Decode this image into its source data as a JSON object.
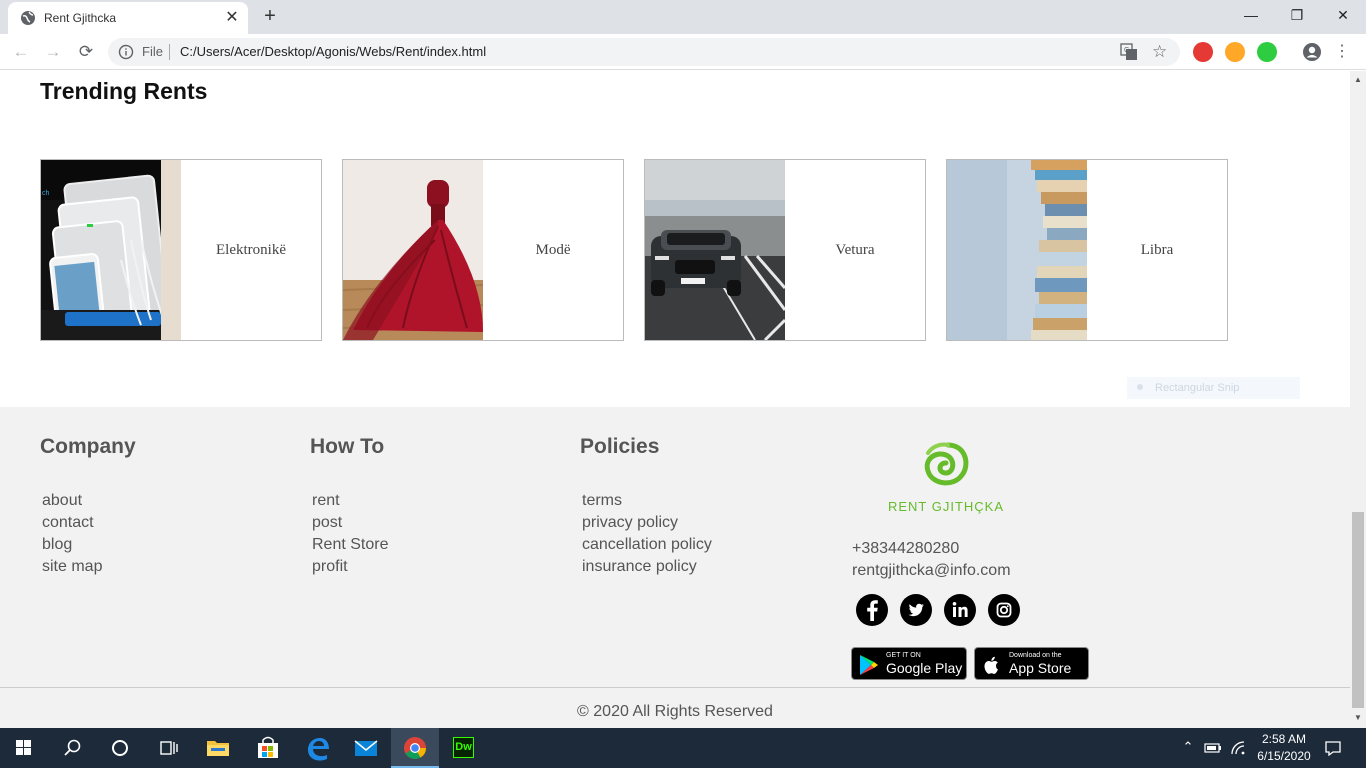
{
  "browser": {
    "tab_title": "Rent Gjithcka",
    "tab_close": "✕",
    "new_tab": "+",
    "window_controls": {
      "minimize": "—",
      "restore": "❐",
      "close": "✕"
    },
    "nav": {
      "back": "←",
      "forward": "→",
      "reload": "⟳"
    },
    "address": {
      "scheme": "File",
      "url": "C:/Users/Acer/Desktop/Agonis/Webs/Rent/index.html"
    },
    "star": "☆",
    "menu": "⋮",
    "extensions": [
      {
        "name": "red-extension-icon",
        "color": "#e53935"
      },
      {
        "name": "orange-extension-icon",
        "color": "#ffa726"
      },
      {
        "name": "green-extension-icon",
        "color": "#2ecc40"
      }
    ]
  },
  "page": {
    "section_title": "Trending Rents",
    "categories": [
      {
        "label": "Elektronikë",
        "image": "tablets-charging-station"
      },
      {
        "label": "Modë",
        "image": "red-ball-gown"
      },
      {
        "label": "Vetura",
        "image": "suv-on-road"
      },
      {
        "label": "Libra",
        "image": "stack-of-books"
      }
    ],
    "snip_overlay": "Rectangular Snip"
  },
  "footer": {
    "columns": [
      {
        "heading": "Company",
        "links": [
          "about",
          "contact",
          "blog",
          "site map"
        ]
      },
      {
        "heading": "How To",
        "links": [
          "rent",
          "post",
          "Rent Store",
          "profit"
        ]
      },
      {
        "heading": "Policies",
        "links": [
          "terms",
          "privacy policy",
          "cancellation policy",
          "insurance policy"
        ]
      }
    ],
    "brand": "RENT GJITHÇKA",
    "brand_color": "#66bb2a",
    "phone": "+38344280280",
    "email": "rentgjithcka@info.com",
    "social": [
      "facebook-icon",
      "twitter-icon",
      "linkedin-icon",
      "instagram-icon"
    ],
    "stores": {
      "google": {
        "small": "GET IT ON",
        "big": "Google Play"
      },
      "apple": {
        "small": "Download on the",
        "big": "App Store"
      }
    },
    "copyright": "© 2020 All Rights Reserved"
  },
  "taskbar": {
    "time": "2:58 AM",
    "date": "6/15/2020",
    "chevron": "⌃",
    "dreamweaver": "Dw"
  }
}
